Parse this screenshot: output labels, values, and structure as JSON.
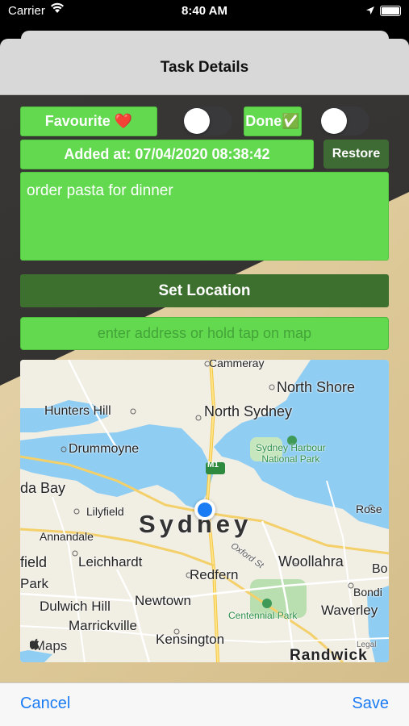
{
  "status_bar": {
    "carrier": "Carrier",
    "time": "8:40 AM"
  },
  "nav": {
    "title": "Task Details"
  },
  "favourite": {
    "label": "Favourite ❤️",
    "on": false
  },
  "done": {
    "label": "Done✅",
    "on": false
  },
  "added_at": "Added at: 07/04/2020 08:38:42",
  "restore_label": "Restore",
  "notes": "order pasta for dinner",
  "set_location_label": "Set Location",
  "address": {
    "value": "",
    "placeholder": "enter address or hold tap on map"
  },
  "map": {
    "labels": {
      "cammeray": "Cammeray",
      "north_shore": "North Shore",
      "hunters_hill": "Hunters Hill",
      "north_sydney": "North Sydney",
      "drummoyne": "Drummoyne",
      "sydney_harbour": "Sydney Harbour",
      "national_park": "National Park",
      "m1": "M1",
      "da_bay": "da Bay",
      "lilyfield": "Lilyfield",
      "rose": "Rose",
      "sydney": "Sydney",
      "annandale": "Annandale",
      "oxford_st": "Oxford St",
      "field": "field",
      "leichhardt": "Leichhardt",
      "woollahra": "Woollahra",
      "bo": "Bo",
      "park": "Park",
      "redfern": "Redfern",
      "bondi": "Bondi",
      "dulwich_hill": "Dulwich Hill",
      "newtown": "Newtown",
      "centennial_park": "Centennial Park",
      "waverley": "Waverley",
      "marrickville": "Marrickville",
      "kensington": "Kensington",
      "legal": "Legal",
      "randwick": "Randwick"
    },
    "brand": " Maps"
  },
  "toolbar": {
    "cancel": "Cancel",
    "save": "Save"
  },
  "colors": {
    "accent_green": "#62d94f",
    "dark_green": "#3d6f2f",
    "ios_blue": "#1a7cf4"
  }
}
